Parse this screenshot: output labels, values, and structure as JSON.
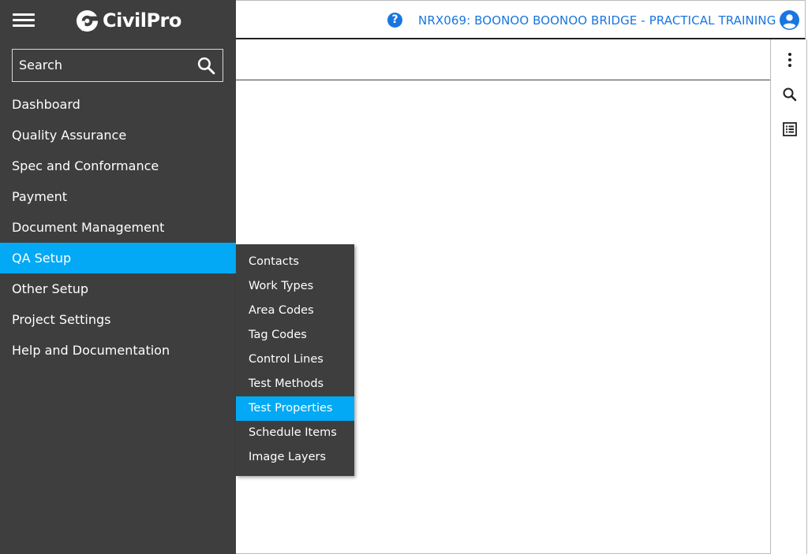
{
  "app": {
    "brand": "CivilPro"
  },
  "header": {
    "project_title": "NRX069: BOONOO BOONOO BRIDGE - PRACTICAL TRAINING",
    "help_icon": "help-circle-icon",
    "user_icon": "account-circle-icon",
    "accent_color": "#1976e0"
  },
  "sidebar": {
    "background": "#3e3e3e",
    "active_color": "#03a9f4",
    "search": {
      "placeholder": "Search",
      "icon": "search-icon"
    },
    "items": [
      {
        "label": "Dashboard"
      },
      {
        "label": "Quality Assurance"
      },
      {
        "label": "Spec and Conformance"
      },
      {
        "label": "Payment"
      },
      {
        "label": "Document Management"
      },
      {
        "label": "QA Setup",
        "active": true
      },
      {
        "label": "Other Setup"
      },
      {
        "label": "Project Settings"
      },
      {
        "label": "Help and Documentation"
      }
    ]
  },
  "submenu": {
    "items": [
      {
        "label": "Contacts"
      },
      {
        "label": "Work Types"
      },
      {
        "label": "Area Codes"
      },
      {
        "label": "Tag Codes"
      },
      {
        "label": "Control Lines"
      },
      {
        "label": "Test Methods"
      },
      {
        "label": "Test Properties",
        "active": true
      },
      {
        "label": "Schedule Items"
      },
      {
        "label": "Image Layers"
      }
    ]
  },
  "right_toolbar": {
    "icons": [
      "more-vertical-icon",
      "search-icon",
      "list-icon"
    ]
  }
}
